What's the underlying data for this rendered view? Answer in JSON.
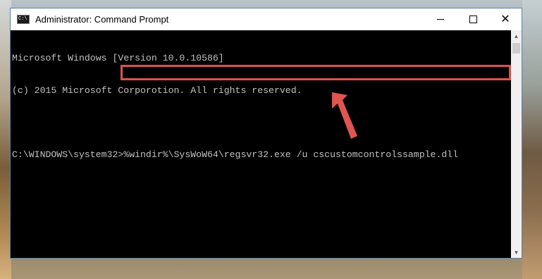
{
  "window": {
    "title": "Administrator: Command Prompt",
    "icon": "C:\\",
    "controls": {
      "minimize": "minimize-icon",
      "maximize": "maximize-icon",
      "close": "close-icon"
    }
  },
  "console": {
    "lines": [
      "Microsoft Windows [Version 10.0.10586]",
      "(c) 2015 Microsoft Corporotion. All rights reserved."
    ],
    "prompt": "C:\\WINDOWS\\system32>",
    "command": "%windir%\\SysWoW64\\regsvr32.exe /u cscustomcontrolssample.dll"
  },
  "annotation": {
    "highlight_color": "#d9534f",
    "arrow_color": "#e05550"
  }
}
